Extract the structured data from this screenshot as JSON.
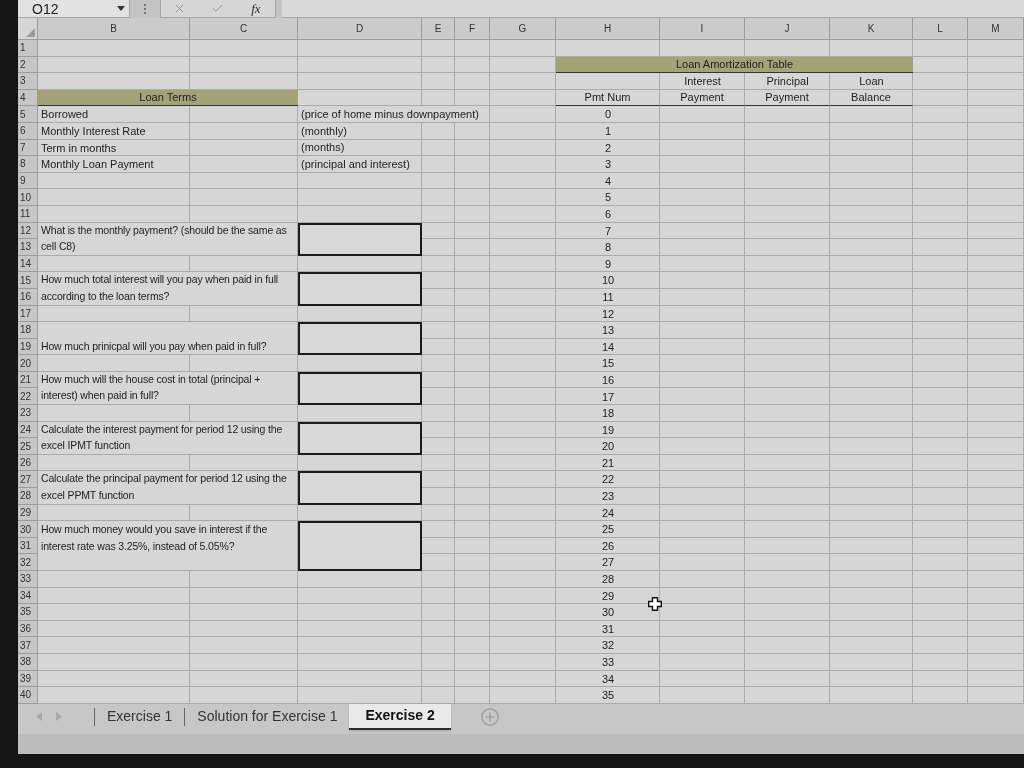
{
  "formula_bar": {
    "name_box": "O12",
    "function_button": "fx"
  },
  "column_headers": [
    "B",
    "C",
    "D",
    "E",
    "F",
    "G",
    "H",
    "I",
    "J",
    "K",
    "L",
    "M"
  ],
  "row_numbers": [
    "1",
    "2",
    "3",
    "4",
    "5",
    "6",
    "7",
    "8",
    "9",
    "10",
    "11",
    "12",
    "13",
    "14",
    "15",
    "16",
    "17",
    "18",
    "19",
    "20",
    "21",
    "22",
    "23",
    "24",
    "25",
    "26",
    "27",
    "28",
    "29",
    "30",
    "31",
    "32",
    "33",
    "34",
    "35",
    "36",
    "37",
    "38",
    "39",
    "40"
  ],
  "loan_terms": {
    "title": "Loan Terms",
    "rows": [
      {
        "label": "Borrowed",
        "note": "(price of home minus downpayment)"
      },
      {
        "label": "Monthly Interest Rate",
        "note": "(monthly)"
      },
      {
        "label": "Term in months",
        "note": "(months)"
      },
      {
        "label": "Monthly Loan Payment",
        "note": "(principal and interest)"
      }
    ]
  },
  "questions": [
    {
      "text": "What is the monthly payment? (should be the same as cell C8)",
      "kind": "short"
    },
    {
      "text": "How much total interest will you pay when paid in full according to the loan terms?",
      "kind": "short"
    },
    {
      "text": "How much prinicpal will you pay when paid in full?",
      "kind": "short"
    },
    {
      "text": "How much will the house cost in total (principal + interest) when paid in full?",
      "kind": "short"
    },
    {
      "text": "Calculate the interest payment for period 12 using the excel IPMT function",
      "kind": "short"
    },
    {
      "text": "Calculate the principal payment for period 12 using the excel PPMT function",
      "kind": "short"
    },
    {
      "text": "How much money would you save in interest if the interest rate was 3.25%, instead of 5.05%?",
      "kind": "tall"
    }
  ],
  "amortization_table": {
    "title": "Loan Amortization Table",
    "columns": [
      {
        "bottom": "Pmt Num"
      },
      {
        "top": "Interest",
        "bottom": "Payment"
      },
      {
        "top": "Principal",
        "bottom": "Payment"
      },
      {
        "top": "Loan",
        "bottom": "Balance"
      }
    ],
    "payment_numbers": [
      "0",
      "1",
      "2",
      "3",
      "4",
      "5",
      "6",
      "7",
      "8",
      "9",
      "10",
      "11",
      "12",
      "13",
      "14",
      "15",
      "16",
      "17",
      "18",
      "19",
      "20",
      "21",
      "22",
      "23",
      "24",
      "25",
      "26",
      "27",
      "28",
      "29",
      "30",
      "31",
      "32",
      "33",
      "34",
      "35"
    ]
  },
  "sheet_tabs": [
    {
      "label": "Exercise 1",
      "selected": false
    },
    {
      "label": "Solution for Exercise 1",
      "selected": false
    },
    {
      "label": "Exercise 2",
      "selected": true
    }
  ]
}
